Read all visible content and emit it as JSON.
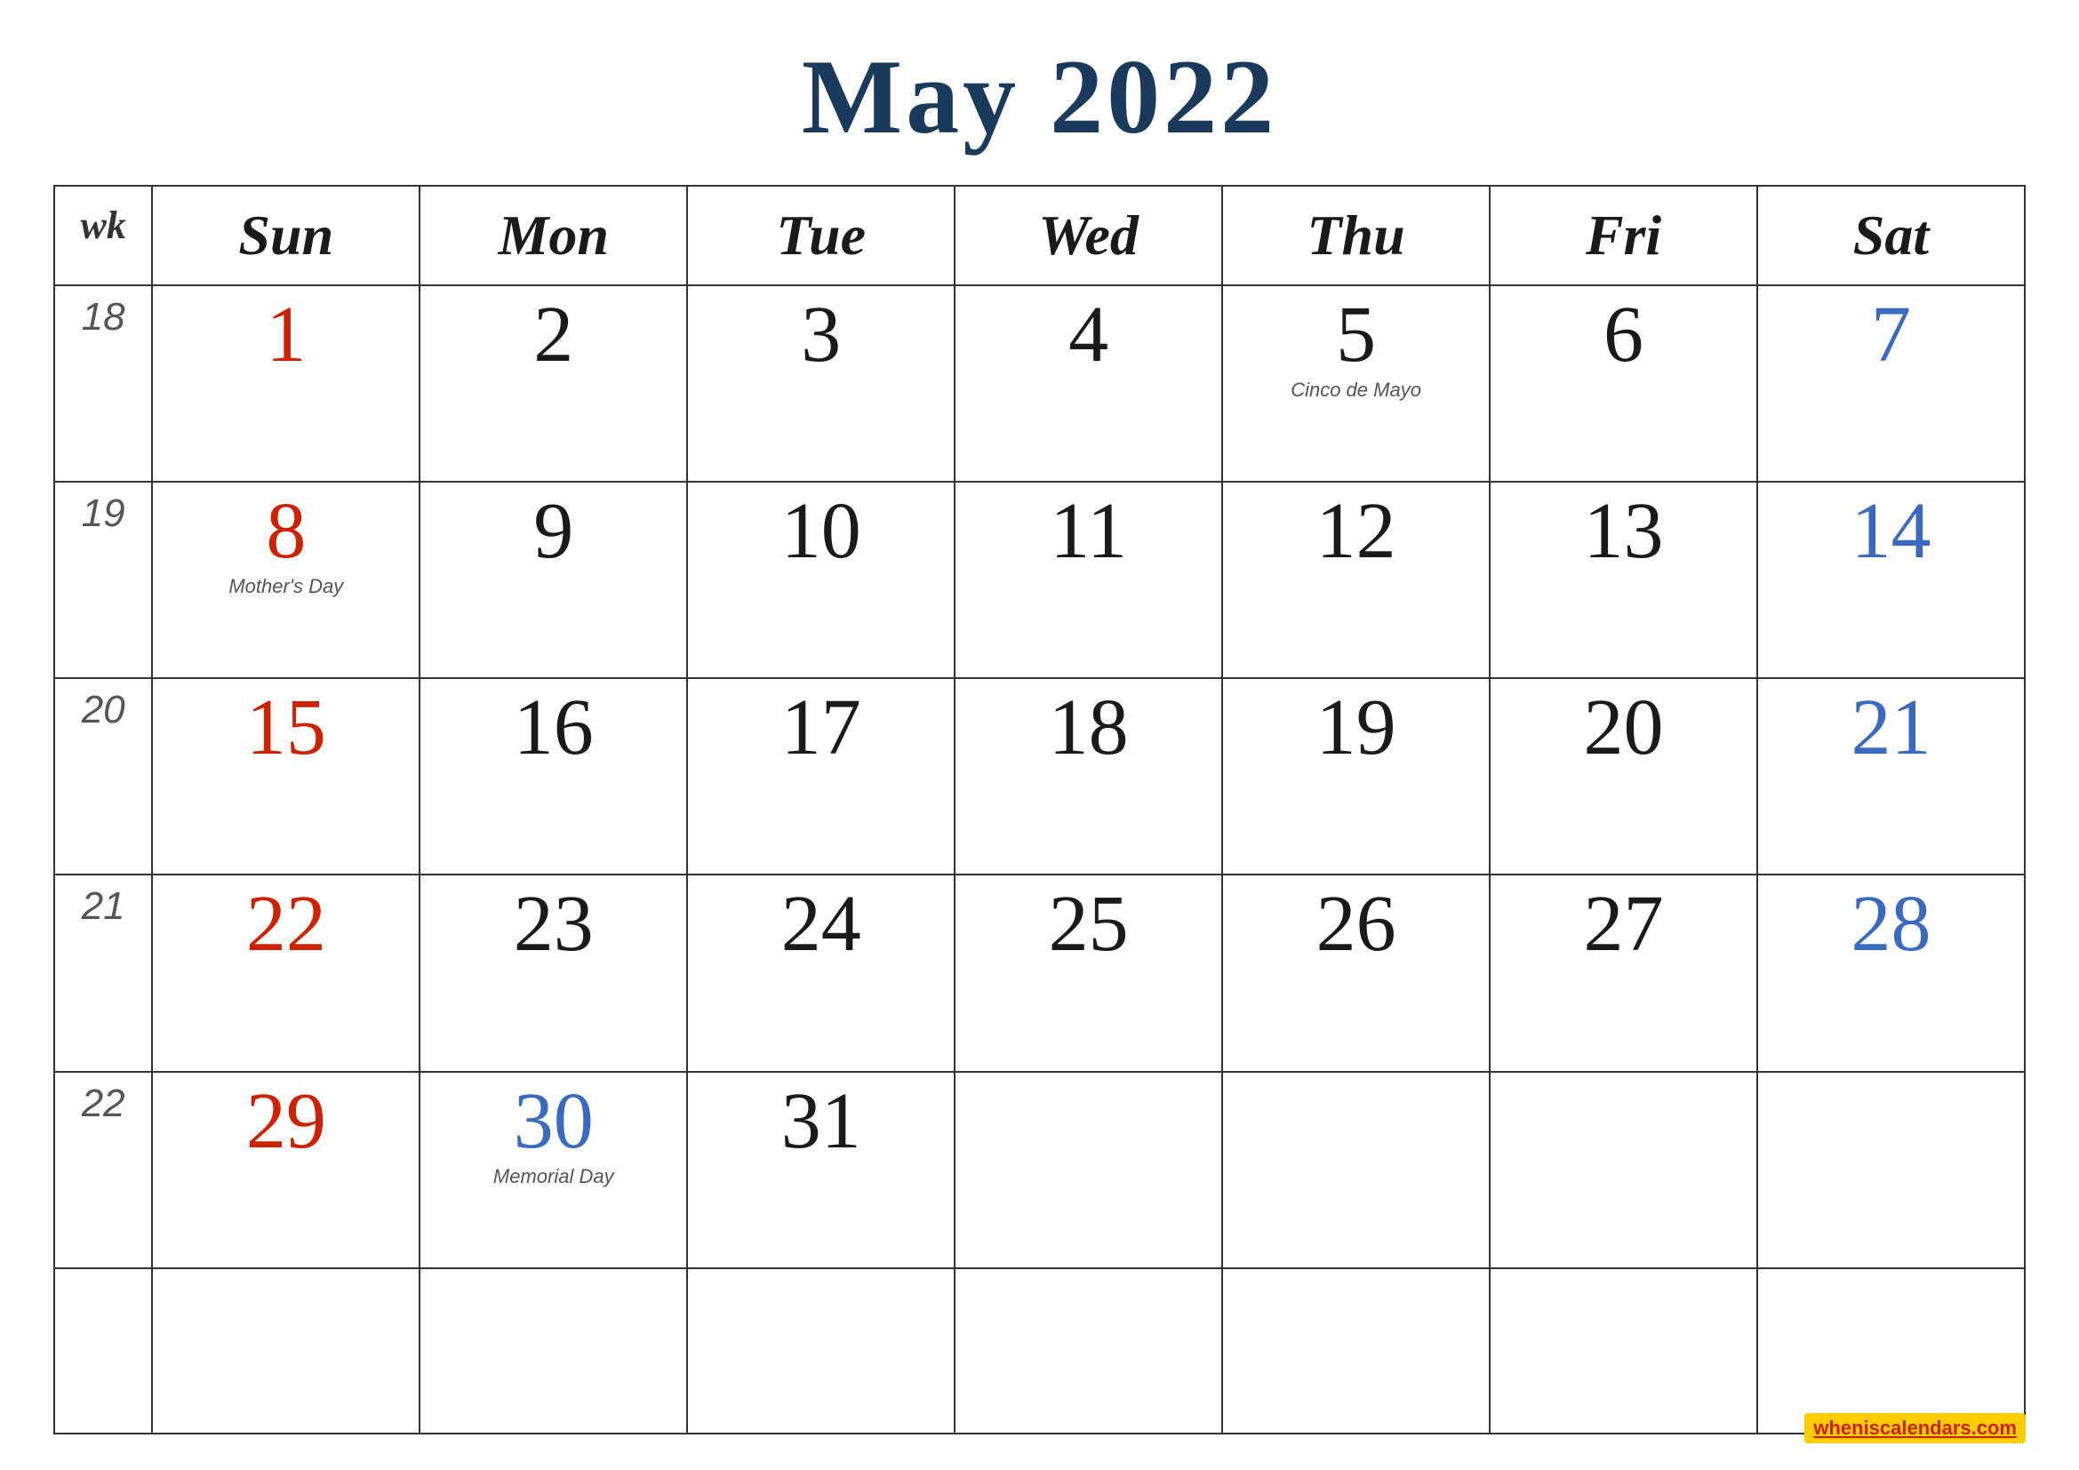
{
  "title": "May 2022",
  "headers": {
    "wk": "wk",
    "sun": "Sun",
    "mon": "Mon",
    "tue": "Tue",
    "wed": "Wed",
    "thu": "Thu",
    "fri": "Fri",
    "sat": "Sat"
  },
  "weeks": [
    {
      "wk": "18",
      "days": [
        {
          "num": "1",
          "color": "red",
          "holiday": ""
        },
        {
          "num": "2",
          "color": "black",
          "holiday": ""
        },
        {
          "num": "3",
          "color": "black",
          "holiday": ""
        },
        {
          "num": "4",
          "color": "black",
          "holiday": ""
        },
        {
          "num": "5",
          "color": "black",
          "holiday": "Cinco de Mayo"
        },
        {
          "num": "6",
          "color": "black",
          "holiday": ""
        },
        {
          "num": "7",
          "color": "blue",
          "holiday": ""
        }
      ]
    },
    {
      "wk": "19",
      "days": [
        {
          "num": "8",
          "color": "red",
          "holiday": "Mother's Day"
        },
        {
          "num": "9",
          "color": "black",
          "holiday": ""
        },
        {
          "num": "10",
          "color": "black",
          "holiday": ""
        },
        {
          "num": "11",
          "color": "black",
          "holiday": ""
        },
        {
          "num": "12",
          "color": "black",
          "holiday": ""
        },
        {
          "num": "13",
          "color": "black",
          "holiday": ""
        },
        {
          "num": "14",
          "color": "blue",
          "holiday": ""
        }
      ]
    },
    {
      "wk": "20",
      "days": [
        {
          "num": "15",
          "color": "red",
          "holiday": ""
        },
        {
          "num": "16",
          "color": "black",
          "holiday": ""
        },
        {
          "num": "17",
          "color": "black",
          "holiday": ""
        },
        {
          "num": "18",
          "color": "black",
          "holiday": ""
        },
        {
          "num": "19",
          "color": "black",
          "holiday": ""
        },
        {
          "num": "20",
          "color": "black",
          "holiday": ""
        },
        {
          "num": "21",
          "color": "blue",
          "holiday": ""
        }
      ]
    },
    {
      "wk": "21",
      "days": [
        {
          "num": "22",
          "color": "red",
          "holiday": ""
        },
        {
          "num": "23",
          "color": "black",
          "holiday": ""
        },
        {
          "num": "24",
          "color": "black",
          "holiday": ""
        },
        {
          "num": "25",
          "color": "black",
          "holiday": ""
        },
        {
          "num": "26",
          "color": "black",
          "holiday": ""
        },
        {
          "num": "27",
          "color": "black",
          "holiday": ""
        },
        {
          "num": "28",
          "color": "blue",
          "holiday": ""
        }
      ]
    },
    {
      "wk": "22",
      "days": [
        {
          "num": "29",
          "color": "red",
          "holiday": ""
        },
        {
          "num": "30",
          "color": "blue",
          "holiday": "Memorial Day"
        },
        {
          "num": "31",
          "color": "black",
          "holiday": ""
        },
        {
          "num": "",
          "color": "black",
          "holiday": ""
        },
        {
          "num": "",
          "color": "black",
          "holiday": ""
        },
        {
          "num": "",
          "color": "black",
          "holiday": ""
        },
        {
          "num": "",
          "color": "black",
          "holiday": ""
        }
      ]
    },
    {
      "wk": "",
      "days": [
        {
          "num": "",
          "color": "black",
          "holiday": ""
        },
        {
          "num": "",
          "color": "black",
          "holiday": ""
        },
        {
          "num": "",
          "color": "black",
          "holiday": ""
        },
        {
          "num": "",
          "color": "black",
          "holiday": ""
        },
        {
          "num": "",
          "color": "black",
          "holiday": ""
        },
        {
          "num": "",
          "color": "black",
          "holiday": ""
        },
        {
          "num": "",
          "color": "black",
          "holiday": ""
        }
      ]
    }
  ],
  "watermark": "wheniscalendars.com"
}
